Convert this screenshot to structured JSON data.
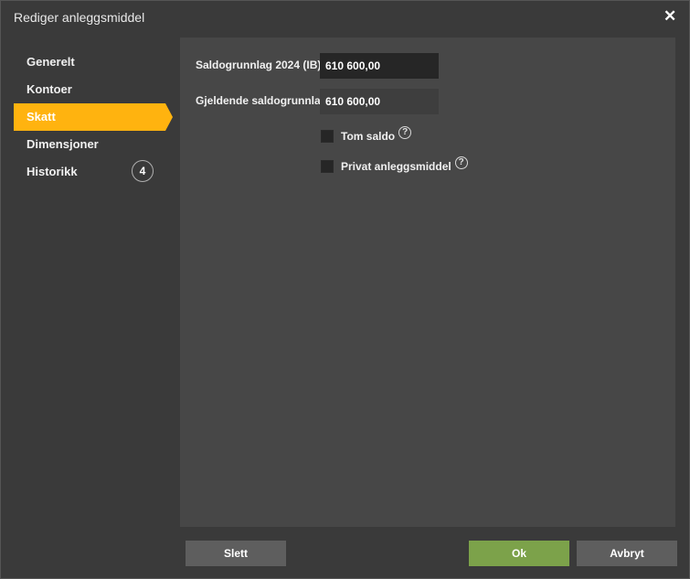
{
  "dialog": {
    "title": "Rediger anleggsmiddel",
    "close_icon": "close-icon"
  },
  "sidebar": {
    "items": [
      {
        "label": "Generelt",
        "active": false
      },
      {
        "label": "Kontoer",
        "active": false
      },
      {
        "label": "Skatt",
        "active": true
      },
      {
        "label": "Dimensjoner",
        "active": false
      },
      {
        "label": "Historikk",
        "active": false,
        "badge": "4"
      }
    ]
  },
  "form": {
    "saldogrunnlag_label": "Saldogrunnlag 2024 (IB)",
    "saldogrunnlag_value": "610 600,00",
    "gjeldende_label": "Gjeldende saldogrunnlag",
    "gjeldende_value": "610 600,00",
    "tom_saldo_label": "Tom saldo",
    "tom_saldo_checked": false,
    "privat_label": "Privat anleggsmiddel",
    "privat_checked": false,
    "help_glyph": "?"
  },
  "buttons": {
    "delete": "Slett",
    "ok": "Ok",
    "cancel": "Avbryt"
  },
  "colors": {
    "accent": "#ffb30f",
    "ok_button": "#7ca24a",
    "panel": "#474747",
    "background": "#3a3a3a"
  }
}
